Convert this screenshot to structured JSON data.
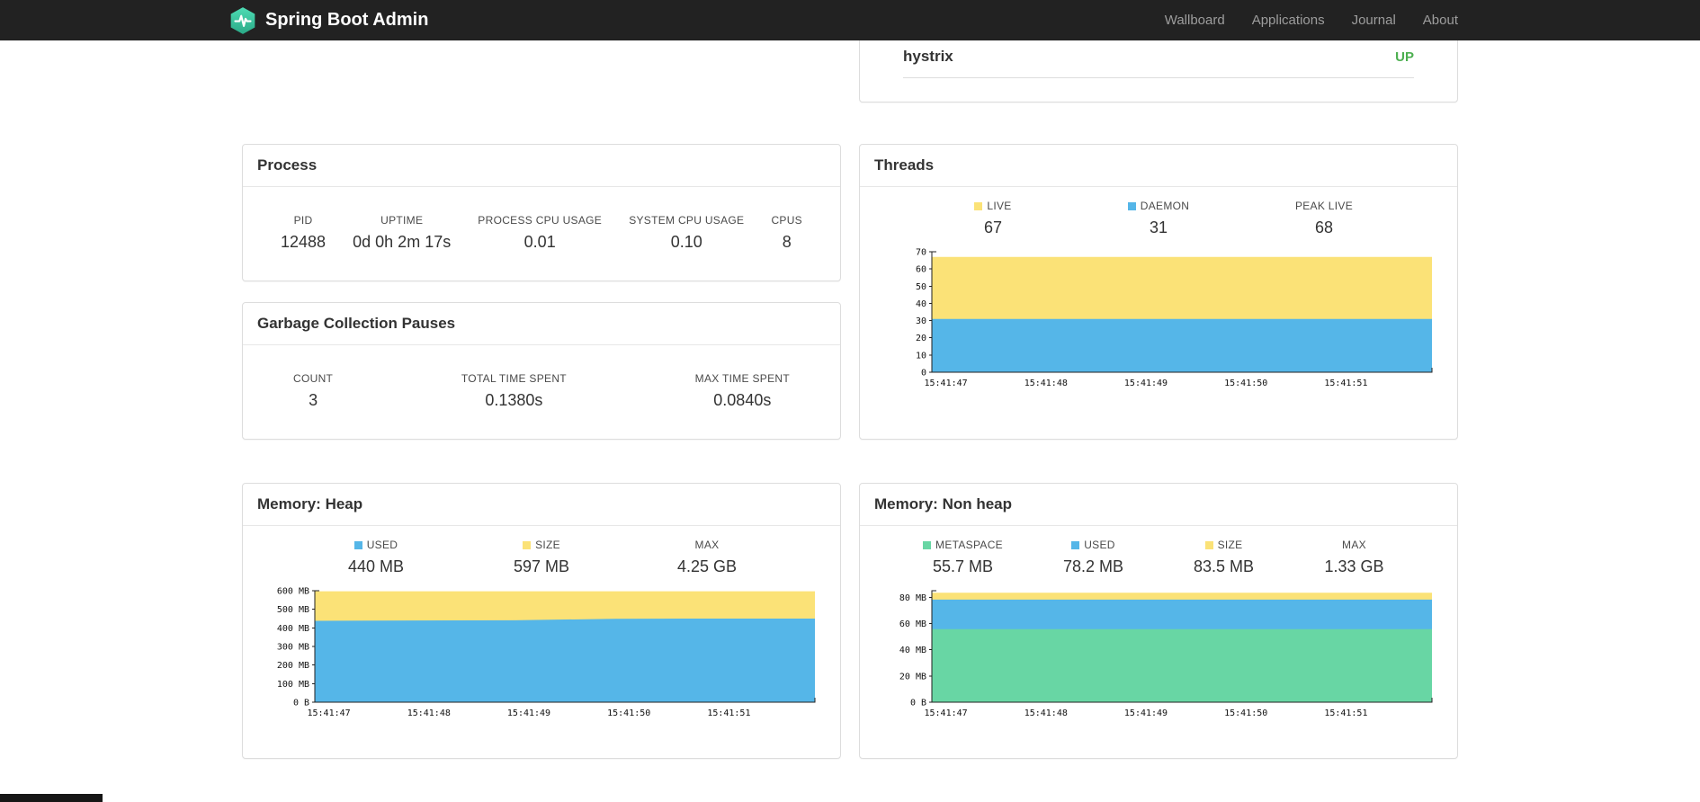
{
  "navbar": {
    "brand": "Spring Boot Admin",
    "links": [
      {
        "label": "Wallboard"
      },
      {
        "label": "Applications"
      },
      {
        "label": "Journal"
      },
      {
        "label": "About"
      }
    ]
  },
  "health": {
    "service": "hystrix",
    "status": "UP",
    "status_color": "#4caf50"
  },
  "process": {
    "title": "Process",
    "metrics": [
      {
        "label": "PID",
        "value": "12488"
      },
      {
        "label": "UPTIME",
        "value": "0d 0h 2m 17s"
      },
      {
        "label": "PROCESS CPU USAGE",
        "value": "0.01"
      },
      {
        "label": "SYSTEM CPU USAGE",
        "value": "0.10"
      },
      {
        "label": "CPUS",
        "value": "8"
      }
    ]
  },
  "gc": {
    "title": "Garbage Collection Pauses",
    "metrics": [
      {
        "label": "COUNT",
        "value": "3"
      },
      {
        "label": "TOTAL TIME SPENT",
        "value": "0.1380s"
      },
      {
        "label": "MAX TIME SPENT",
        "value": "0.0840s"
      }
    ]
  },
  "threads": {
    "title": "Threads",
    "metrics": [
      {
        "label": "LIVE",
        "value": "67",
        "legend": "#fbe277"
      },
      {
        "label": "DAEMON",
        "value": "31",
        "legend": "#55b6e8"
      },
      {
        "label": "PEAK LIVE",
        "value": "68"
      }
    ]
  },
  "heap": {
    "title": "Memory: Heap",
    "metrics": [
      {
        "label": "USED",
        "value": "440 MB",
        "legend": "#55b6e8"
      },
      {
        "label": "SIZE",
        "value": "597 MB",
        "legend": "#fbe277"
      },
      {
        "label": "MAX",
        "value": "4.25 GB"
      }
    ]
  },
  "nonheap": {
    "title": "Memory: Non heap",
    "metrics": [
      {
        "label": "METASPACE",
        "value": "55.7 MB",
        "legend": "#68d6a4"
      },
      {
        "label": "USED",
        "value": "78.2 MB",
        "legend": "#55b6e8"
      },
      {
        "label": "SIZE",
        "value": "83.5 MB",
        "legend": "#fbe277"
      },
      {
        "label": "MAX",
        "value": "1.33 GB"
      }
    ]
  },
  "colors": {
    "navbar_bg": "#222222",
    "nav_link": "#9d9d9d",
    "panel_border": "#dddddd",
    "status_up": "#4caf50",
    "series_yellow": "#fbe277",
    "series_blue": "#55b6e8",
    "series_green": "#68d6a4",
    "logo_teal": "#3cc9a2"
  },
  "chart_data": [
    {
      "id": "threads",
      "type": "area",
      "title": "Threads",
      "x": [
        "15:41:47",
        "15:41:48",
        "15:41:49",
        "15:41:50",
        "15:41:51"
      ],
      "ylim": [
        0,
        70
      ],
      "yticks": [
        {
          "v": 0,
          "label": "0"
        },
        {
          "v": 10,
          "label": "10"
        },
        {
          "v": 20,
          "label": "20"
        },
        {
          "v": 30,
          "label": "30"
        },
        {
          "v": 40,
          "label": "40"
        },
        {
          "v": 50,
          "label": "50"
        },
        {
          "v": 60,
          "label": "60"
        },
        {
          "v": 70,
          "label": "70"
        }
      ],
      "series": [
        {
          "name": "LIVE",
          "color": "#fbe277",
          "values": [
            67,
            67,
            67,
            67,
            67,
            67
          ]
        },
        {
          "name": "DAEMON",
          "color": "#55b6e8",
          "values": [
            31,
            31,
            31,
            31,
            31,
            31
          ]
        }
      ],
      "legend_position": "top",
      "grid": false
    },
    {
      "id": "heap",
      "type": "area",
      "title": "Memory: Heap",
      "x": [
        "15:41:47",
        "15:41:48",
        "15:41:49",
        "15:41:50",
        "15:41:51"
      ],
      "ylim": [
        0,
        600
      ],
      "yticks": [
        {
          "v": 0,
          "label": "0 B"
        },
        {
          "v": 100,
          "label": "100 MB"
        },
        {
          "v": 200,
          "label": "200 MB"
        },
        {
          "v": 300,
          "label": "300 MB"
        },
        {
          "v": 400,
          "label": "400 MB"
        },
        {
          "v": 500,
          "label": "500 MB"
        },
        {
          "v": 600,
          "label": "600 MB"
        }
      ],
      "series": [
        {
          "name": "SIZE",
          "color": "#fbe277",
          "values": [
            597,
            597,
            597,
            597,
            597,
            597
          ]
        },
        {
          "name": "USED",
          "color": "#55b6e8",
          "values": [
            438,
            440,
            441,
            449,
            450,
            450
          ]
        }
      ],
      "legend_position": "top",
      "grid": false
    },
    {
      "id": "nonheap",
      "type": "area",
      "title": "Memory: Non heap",
      "x": [
        "15:41:47",
        "15:41:48",
        "15:41:49",
        "15:41:50",
        "15:41:51"
      ],
      "ylim": [
        0,
        85
      ],
      "yticks": [
        {
          "v": 0,
          "label": "0 B"
        },
        {
          "v": 20,
          "label": "20 MB"
        },
        {
          "v": 40,
          "label": "40 MB"
        },
        {
          "v": 60,
          "label": "60 MB"
        },
        {
          "v": 80,
          "label": "80 MB"
        }
      ],
      "series": [
        {
          "name": "SIZE",
          "color": "#fbe277",
          "values": [
            83.5,
            83.5,
            83.5,
            83.5,
            83.5,
            83.5
          ]
        },
        {
          "name": "USED",
          "color": "#55b6e8",
          "values": [
            78.2,
            78.2,
            78.2,
            78.2,
            78.2,
            78.2
          ]
        },
        {
          "name": "METASPACE",
          "color": "#68d6a4",
          "values": [
            55.7,
            55.7,
            55.7,
            55.7,
            55.7,
            55.7
          ]
        }
      ],
      "legend_position": "top",
      "grid": false
    }
  ]
}
